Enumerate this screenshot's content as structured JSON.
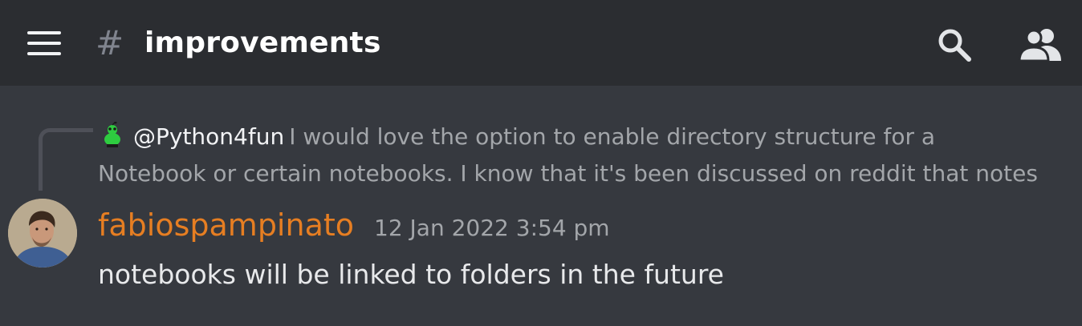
{
  "header": {
    "channel_prefix": "#",
    "channel_name": "improvements",
    "icons": {
      "menu": "hamburger-menu-icon",
      "search": "search-icon",
      "members": "members-icon"
    }
  },
  "reply": {
    "author": "@Python4fun",
    "text_line1": "I would love the option to enable directory structure for a",
    "text_line2": "Notebook or certain notebooks. I know that it's been discussed on reddit that notes",
    "avatar_icon": "reddit-alien-icon"
  },
  "message": {
    "author": "fabiospampinato",
    "timestamp": "12 Jan 2022 3:54 pm",
    "text": "notebooks will be linked to folders in the future",
    "author_color": "#e67e22"
  },
  "colors": {
    "background": "#36393f",
    "header_background": "#2b2d31",
    "muted_text": "#a3a6aa",
    "primary_text": "#e8e9eb"
  }
}
